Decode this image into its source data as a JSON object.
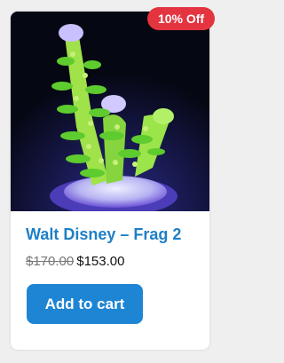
{
  "badge": {
    "label": "10% Off",
    "color": "#e4343f"
  },
  "product": {
    "title": "Walt Disney – Frag 2",
    "title_color": "#1f7fc6",
    "old_price": "$170.00",
    "new_price": "$153.00",
    "image_icon": "coral-frag-photo"
  },
  "cart": {
    "button_label": "Add to cart",
    "button_color": "#1e85d4"
  }
}
